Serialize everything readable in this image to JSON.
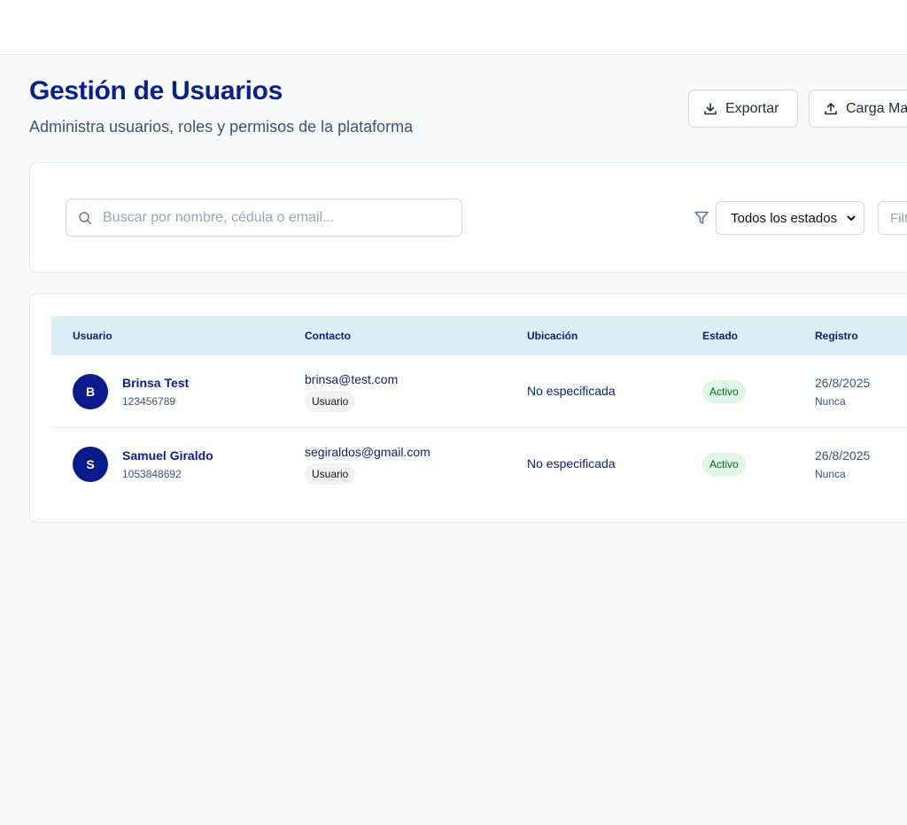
{
  "header": {
    "title": "Gestión de Usuarios",
    "subtitle": "Administra usuarios, roles y permisos de la plataforma",
    "export_label": "Exportar",
    "upload_label": "Carga Ma"
  },
  "filters": {
    "search_placeholder": "Buscar por nombre, cédula o email...",
    "status_selected": "Todos los estados",
    "second_filter_placeholder": "Filt"
  },
  "table": {
    "columns": [
      "Usuario",
      "Contacto",
      "Ubicación",
      "Estado",
      "Registro"
    ],
    "rows": [
      {
        "initial": "B",
        "name": "Brinsa Test",
        "id": "123456789",
        "email": "brinsa@test.com",
        "role": "Usuario",
        "location": "No especificada",
        "status": "Activo",
        "registered": "26/8/2025",
        "last_access": "Nunca"
      },
      {
        "initial": "S",
        "name": "Samuel Giraldo",
        "id": "1053848692",
        "email": "segiraldos@gmail.com",
        "role": "Usuario",
        "location": "No especificada",
        "status": "Activo",
        "registered": "26/8/2025",
        "last_access": "Nunca"
      }
    ]
  },
  "icons": {
    "export": "download-icon",
    "upload": "upload-icon",
    "search": "search-icon",
    "filter": "filter-icon",
    "select": "chevron-down-icon"
  },
  "colors": {
    "primary": "#0b1f8a",
    "table_header_bg": "#d8f0f5",
    "status_active_bg": "#dcf7e3",
    "status_active_text": "#155e2b"
  }
}
